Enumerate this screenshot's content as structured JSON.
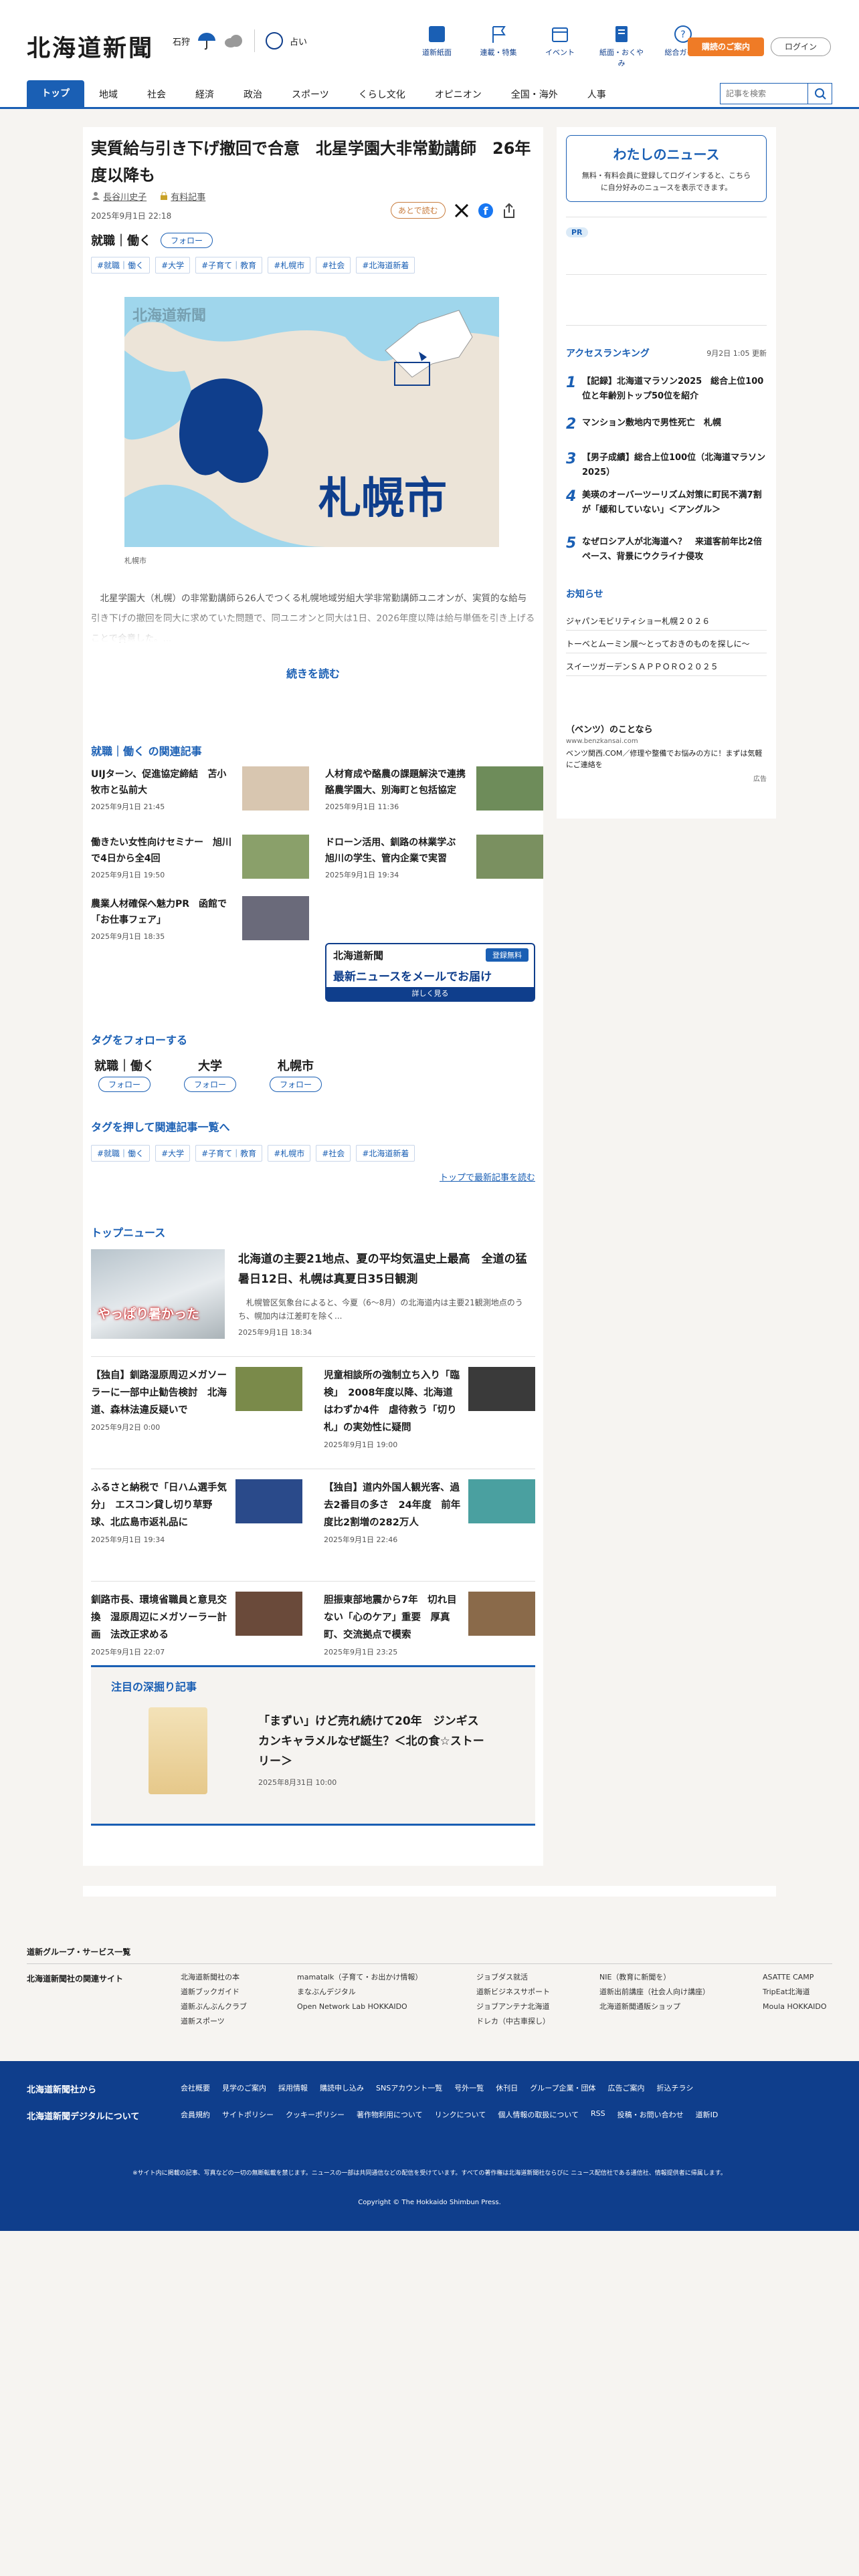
{
  "header": {
    "logo": "北海道新聞",
    "weather": {
      "city": "石狩",
      "fortune": "占い"
    },
    "icons": [
      {
        "name": "newspaper-icon",
        "label": "道新紙面"
      },
      {
        "name": "flag-icon",
        "label": "連載・特集"
      },
      {
        "name": "calendar-icon",
        "label": "イベント"
      },
      {
        "name": "book-icon",
        "label": "紙面・おくやみ"
      },
      {
        "name": "help-icon",
        "label": "総合ガイド"
      }
    ],
    "subscribe": "購読のご案内",
    "login": "ログイン"
  },
  "nav": {
    "items": [
      "トップ",
      "地域",
      "社会",
      "経済",
      "政治",
      "スポーツ",
      "くらし文化",
      "オピニオン",
      "全国・海外",
      "人事"
    ],
    "active": 0,
    "search_placeholder": "記事を検索"
  },
  "article": {
    "title": "実質給与引き下げ撤回で合意　北星学園大非常勤講師　26年度以降も",
    "author": "長谷川史子",
    "badge": "有料記事",
    "date": "2025年9月1日 22:18",
    "save": "あとで読む",
    "genre": "就職｜働く",
    "follow": "フォロー",
    "tags": [
      "#就職｜働く",
      "#大学",
      "#子育て｜教育",
      "#札幌市",
      "#社会",
      "#北海道新着"
    ],
    "map_logo": "北海道新聞",
    "map_city": "札幌市",
    "caption": "札幌市",
    "lead": "北星学園大（札幌）の非常勤講師ら26人でつくる札幌地域労組大学非常勤講師ユニオンが、実質的な給与引き下げの撤回を同大に求めていた問題で、同ユニオンと同大は1日、2026年度以降は給与単価を引き上げることで合意した。...",
    "more": "続きを読む"
  },
  "related": {
    "title": "就職｜働く の関連記事",
    "items": [
      {
        "title": "UIJターン、促進協定締結　苫小牧市と弘前大",
        "date": "2025年9月1日 21:45"
      },
      {
        "title": "人材育成や酪農の課題解決で連携　酪農学園大、別海町と包括協定",
        "date": "2025年9月1日 11:36"
      },
      {
        "title": "働きたい女性向けセミナー　旭川で4日から全4回",
        "date": "2025年9月1日 19:50"
      },
      {
        "title": "ドローン活用、釧路の林業学ぶ　旭川の学生、管内企業で実習",
        "date": "2025年9月1日 19:34"
      },
      {
        "title": "農業人材確保へ魅力PR　函館で「お仕事フェア」",
        "date": "2025年9月1日 18:35"
      }
    ],
    "banner": {
      "logo": "北海道新聞",
      "tag": "登録無料",
      "headline": "最新ニュースをメールでお届け",
      "cta": "詳しく見る"
    }
  },
  "follow_tags": {
    "title": "タグをフォローする",
    "items": [
      "就職｜働く",
      "大学",
      "札幌市"
    ],
    "btn": "フォロー",
    "list_title": "タグを押して関連記事一覧へ",
    "link": "トップで最新記事を読む"
  },
  "top_news": {
    "title": "トップニュース",
    "lead": {
      "title": "北海道の主要21地点、夏の平均気温史上最高　全道の猛暑日12日、札幌は真夏日35日観測",
      "summary": "札幌管区気象台によると、今夏（6～8月）の北海道内は主要21観測地点のうち、幌加内は江差町を除く...",
      "date": "2025年9月1日 18:34",
      "photo_text": "やっぱり暑かった"
    },
    "items": [
      {
        "title": "【独自】釧路湿原周辺メガソーラーに一部中止勧告検討　北海道、森林法違反疑いで",
        "date": "2025年9月2日 0:00"
      },
      {
        "title": "児童相談所の強制立ち入り「臨検」　2008年度以降、北海道はわずか4件　虐待救う「切り札」の実効性に疑問",
        "date": "2025年9月1日 19:00"
      },
      {
        "title": "ふるさと納税で「日ハム選手気分」　エスコン貸し切り草野球、北広島市返礼品に",
        "date": "2025年9月1日 19:34"
      },
      {
        "title": "【独自】道内外国人観光客、過去2番目の多さ　24年度　前年度比2割増の282万人",
        "date": "2025年9月1日 22:46"
      },
      {
        "title": "釧路市長、環境省職員と意見交換　湿原周辺にメガソーラー計画　法改正求める",
        "date": "2025年9月1日 22:07"
      },
      {
        "title": "胆振東部地震から7年　切れ目ない「心のケア」重要　厚真町、交流拠点で模索",
        "date": "2025年9月1日 23:25"
      }
    ]
  },
  "deep": {
    "title": "注目の深掘り記事",
    "article": "「まずい」けど売れ続けて20年　ジンギスカンキャラメルなぜ誕生？＜北の食☆ストーリー＞",
    "date": "2025年8月31日 10:00"
  },
  "sidebar": {
    "my_news": {
      "title": "わたしのニュース",
      "text": "無料・有料会員に登録してログインすると、こちらに自分好みのニュースを表示できます。",
      "login_word": "ログイン"
    },
    "pr": "PR",
    "ranking": {
      "title": "アクセスランキング",
      "updated": "9月2日 1:05 更新",
      "items": [
        "【記録】北海道マラソン2025　総合上位100位と年齢別トップ50位を紹介",
        "マンション敷地内で男性死亡　札幌",
        "【男子成績】総合上位100位（北海道マラソン2025）",
        "美瑛のオーバーツーリズム対策に町民不満7割が「緩和していない」＜アングル＞",
        "なぜロシア人が北海道へ？　来道客前年比2倍ペース、背景にウクライナ侵攻"
      ]
    },
    "notice": {
      "title": "お知らせ",
      "items": [
        "ジャパンモビリティショー札幌２０２６",
        "トーベとムーミン展～とっておきのものを探しに～",
        "スイーツガーデンＳＡＰＰＯＲＯ２０２５"
      ]
    },
    "ad": {
      "title": "（ベンツ）のことなら",
      "url": "www.benzkansai.com",
      "text": "ベンツ関西.COM／修理や整備でお悩みの方に！まずは気軽にご連絡を",
      "label": "広告"
    }
  },
  "footer": {
    "group_title": "道新グループ・サービス一覧",
    "related_title": "北海道新聞社の関連サイト",
    "cols": [
      [
        "北海道新聞社の本",
        "道新ブックガイド",
        "道新ぶんぶんクラブ",
        "道新スポーツ"
      ],
      [
        "mamatalk（子育て・お出かけ情報）",
        "まなぶんデジタル",
        "Open Network Lab HOKKAIDO"
      ],
      [
        "ジョブダス就活",
        "道新ビジネスサポート",
        "ジョブアンテナ北海道",
        "ドレカ（中古車探し）"
      ],
      [
        "NIE（教育に新聞を）",
        "道新出前講座（社会人向け講座）",
        "北海道新聞通販ショップ"
      ],
      [
        "ASATTE CAMP",
        "TripEat北海道",
        "Moula HOKKAIDO"
      ]
    ],
    "from": "北海道新聞社から",
    "digital": "北海道新聞デジタルについて",
    "row1": [
      "会社概要",
      "見学のご案内",
      "採用情報",
      "購読申し込み",
      "SNSアカウント一覧",
      "号外一覧",
      "休刊日",
      "グループ企業・団体",
      "広告ご案内",
      "折込チラシ"
    ],
    "row2": [
      "会員規約",
      "サイトポリシー",
      "クッキーポリシー",
      "著作物利用について",
      "リンクについて",
      "個人情報の取扱について",
      "RSS",
      "投稿・お問い合わせ",
      "道新ID"
    ],
    "notice": "※サイト内に掲載の記事、写真などの一切の無断転載を禁じます。ニュースの一部は共同通信などの配信を受けています。すべての著作権は北海道新聞社ならびに ニュース配信社である通信社、情報提供者に帰属します。",
    "copyright": "Copyright © The Hokkaido Shimbun Press."
  }
}
